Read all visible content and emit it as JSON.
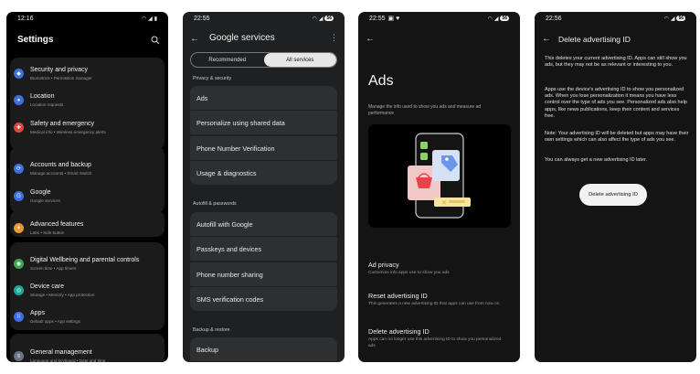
{
  "phone1": {
    "time": "12:16",
    "title": "Settings",
    "items": [
      {
        "title": "Security and privacy",
        "sub": "Biometrics  •  Permission manager",
        "color": "#3d6fe0",
        "icon": "shield-icon"
      },
      {
        "title": "Location",
        "sub": "Location requests",
        "color": "#3d6fe0",
        "icon": "location-icon"
      },
      {
        "title": "Safety and emergency",
        "sub": "Medical info  •  Wireless emergency alerts",
        "color": "#e0443d",
        "icon": "emergency-icon"
      },
      {
        "title": "Accounts and backup",
        "sub": "Manage accounts  •  Smart Switch",
        "color": "#3d6fe0",
        "icon": "sync-icon"
      },
      {
        "title": "Google",
        "sub": "Google services",
        "color": "#3d6fe0",
        "icon": "google-icon"
      },
      {
        "title": "Advanced features",
        "sub": "Labs  •  Side button",
        "color": "#e79a2f",
        "icon": "gear-plus-icon"
      },
      {
        "title": "Digital Wellbeing and parental controls",
        "sub": "Screen time  •  App timers",
        "color": "#3fa552",
        "icon": "wellbeing-icon"
      },
      {
        "title": "Device care",
        "sub": "Storage  •  Memory  •  App protection",
        "color": "#22a59a",
        "icon": "device-care-icon"
      },
      {
        "title": "Apps",
        "sub": "Default apps  •  App settings",
        "color": "#3d6fe0",
        "icon": "apps-icon"
      },
      {
        "title": "General management",
        "sub": "Language and keyboard  •  Date and time",
        "color": "#6b7386",
        "icon": "management-icon"
      }
    ]
  },
  "phone2": {
    "time": "22:55",
    "battery": "56",
    "title": "Google services",
    "tabs": [
      "Recommended",
      "All services"
    ],
    "sections": [
      {
        "label": "Privacy & security",
        "items": [
          "Ads",
          "Personalize using shared data",
          "Phone Number Verification",
          "Usage & diagnostics"
        ]
      },
      {
        "label": "Autofill & passwords",
        "items": [
          "Autofill with Google",
          "Passkeys and devices",
          "Phone number sharing",
          "SMS verification codes"
        ]
      },
      {
        "label": "Backup & restore",
        "items": [
          "Backup"
        ]
      }
    ]
  },
  "phone3": {
    "time": "22:55",
    "battery": "56",
    "title": "Ads",
    "description": "Manage the info used to show you ads and measure ad performance",
    "items": [
      {
        "title": "Ad privacy",
        "sub": "Customize info apps use to show you ads"
      },
      {
        "title": "Reset advertising ID",
        "sub": "This generates a new advertising ID that apps can use from now on"
      },
      {
        "title": "Delete advertising ID",
        "sub": "Apps can no longer use this advertising ID to show you personalized ads"
      }
    ]
  },
  "phone4": {
    "time": "22:56",
    "battery": "56",
    "title": "Delete advertising ID",
    "paragraphs": [
      "This deletes your current advertising ID. Apps can still show you ads, but they may not be as relevant or interesting to you.",
      "Apps use the device's advertising ID to show you personalized ads. When you lose personalization it means you have less control over the type of ads you see. Personalized ads also help apps, like news publications, keep their content and services free.",
      "Note: Your advertising ID will be deleted but apps may have their own settings which can also affect the type of ads you see.",
      "You can always get a new advertising ID later."
    ],
    "button": "Delete advertising ID"
  }
}
